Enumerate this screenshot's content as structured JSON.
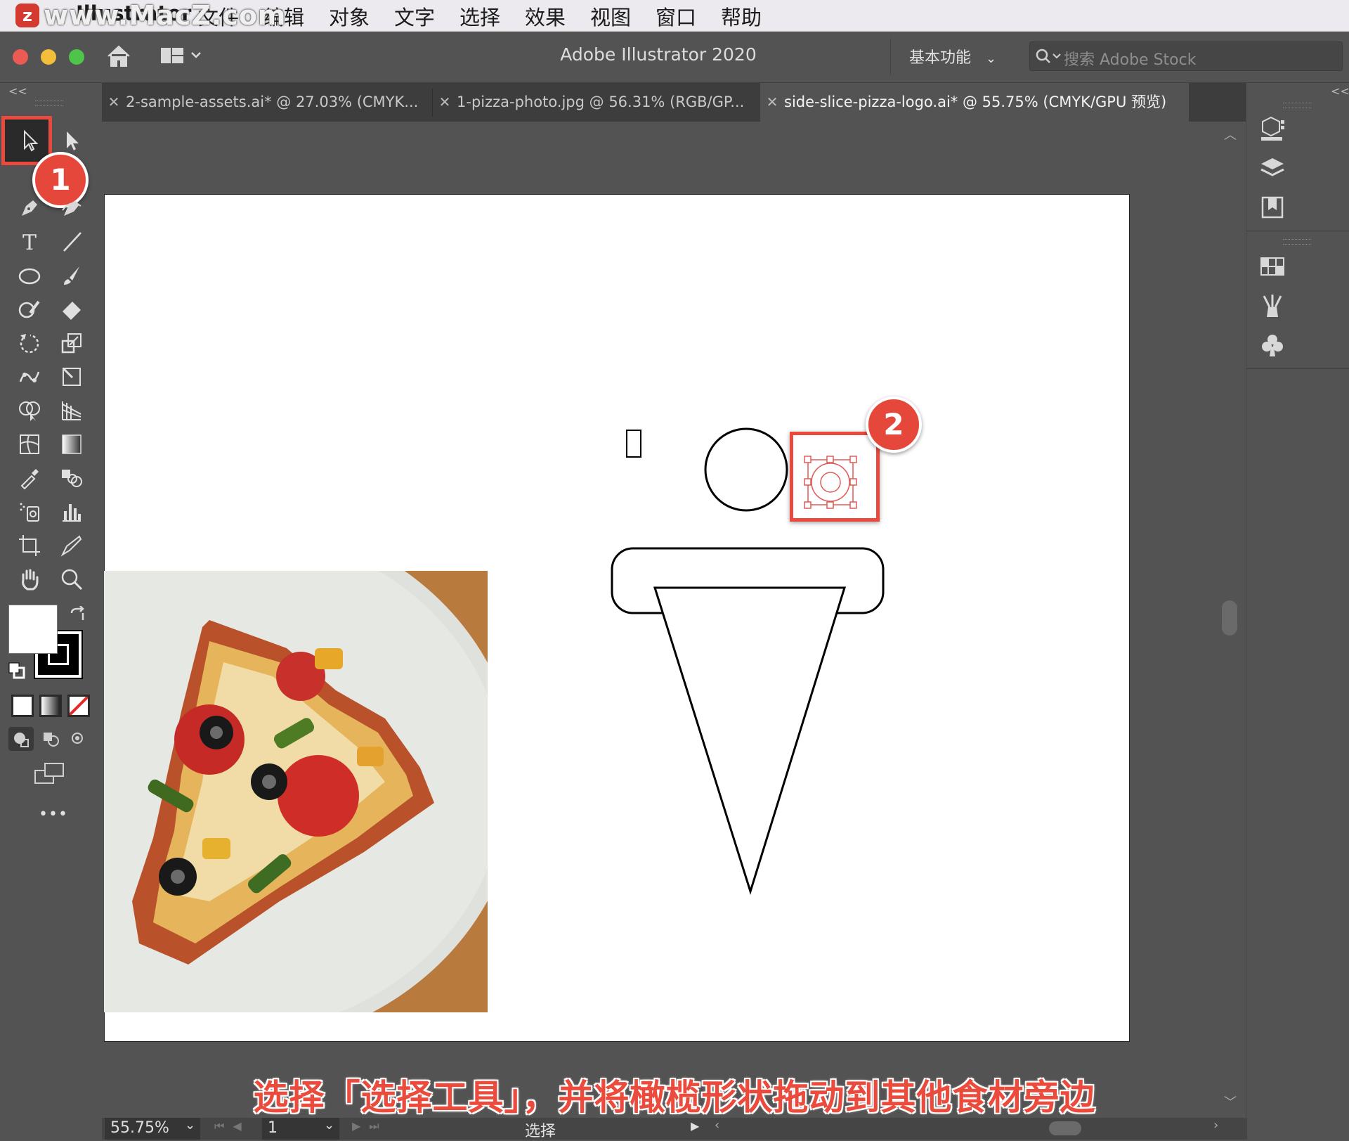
{
  "menubar": {
    "app_name": "Illustrator",
    "items": [
      "文件",
      "编辑",
      "对象",
      "文字",
      "选择",
      "效果",
      "视图",
      "窗口",
      "帮助"
    ],
    "watermark": "www.MacZ.com"
  },
  "appbar": {
    "title": "Adobe Illustrator 2020",
    "workspace_label": "基本功能",
    "search_placeholder": "搜索 Adobe Stock",
    "collapse_glyph": "<<"
  },
  "tabs": [
    {
      "label": "2-sample-assets.ai* @ 27.03% (CMYK...",
      "active": false
    },
    {
      "label": "1-pizza-photo.jpg @ 56.31% (RGB/GP...",
      "active": false
    },
    {
      "label": "side-slice-pizza-logo.ai* @ 55.75% (CMYK/GPU 预览)",
      "active": true
    }
  ],
  "annotations": {
    "badge_1": "1",
    "badge_2": "2",
    "caption": "选择「选择工具」，并将橄榄形状拖动到其他食材旁边"
  },
  "statusbar": {
    "zoom": "55.75%",
    "artboard_number": "1",
    "current_tool": "选择"
  },
  "toolbar": {
    "more_label": "•••"
  },
  "colors": {
    "accent_red": "#e5483a",
    "menubar_bg": "#eceaee",
    "ui_bg": "#535353",
    "tab_bg": "#3d3d3d"
  }
}
